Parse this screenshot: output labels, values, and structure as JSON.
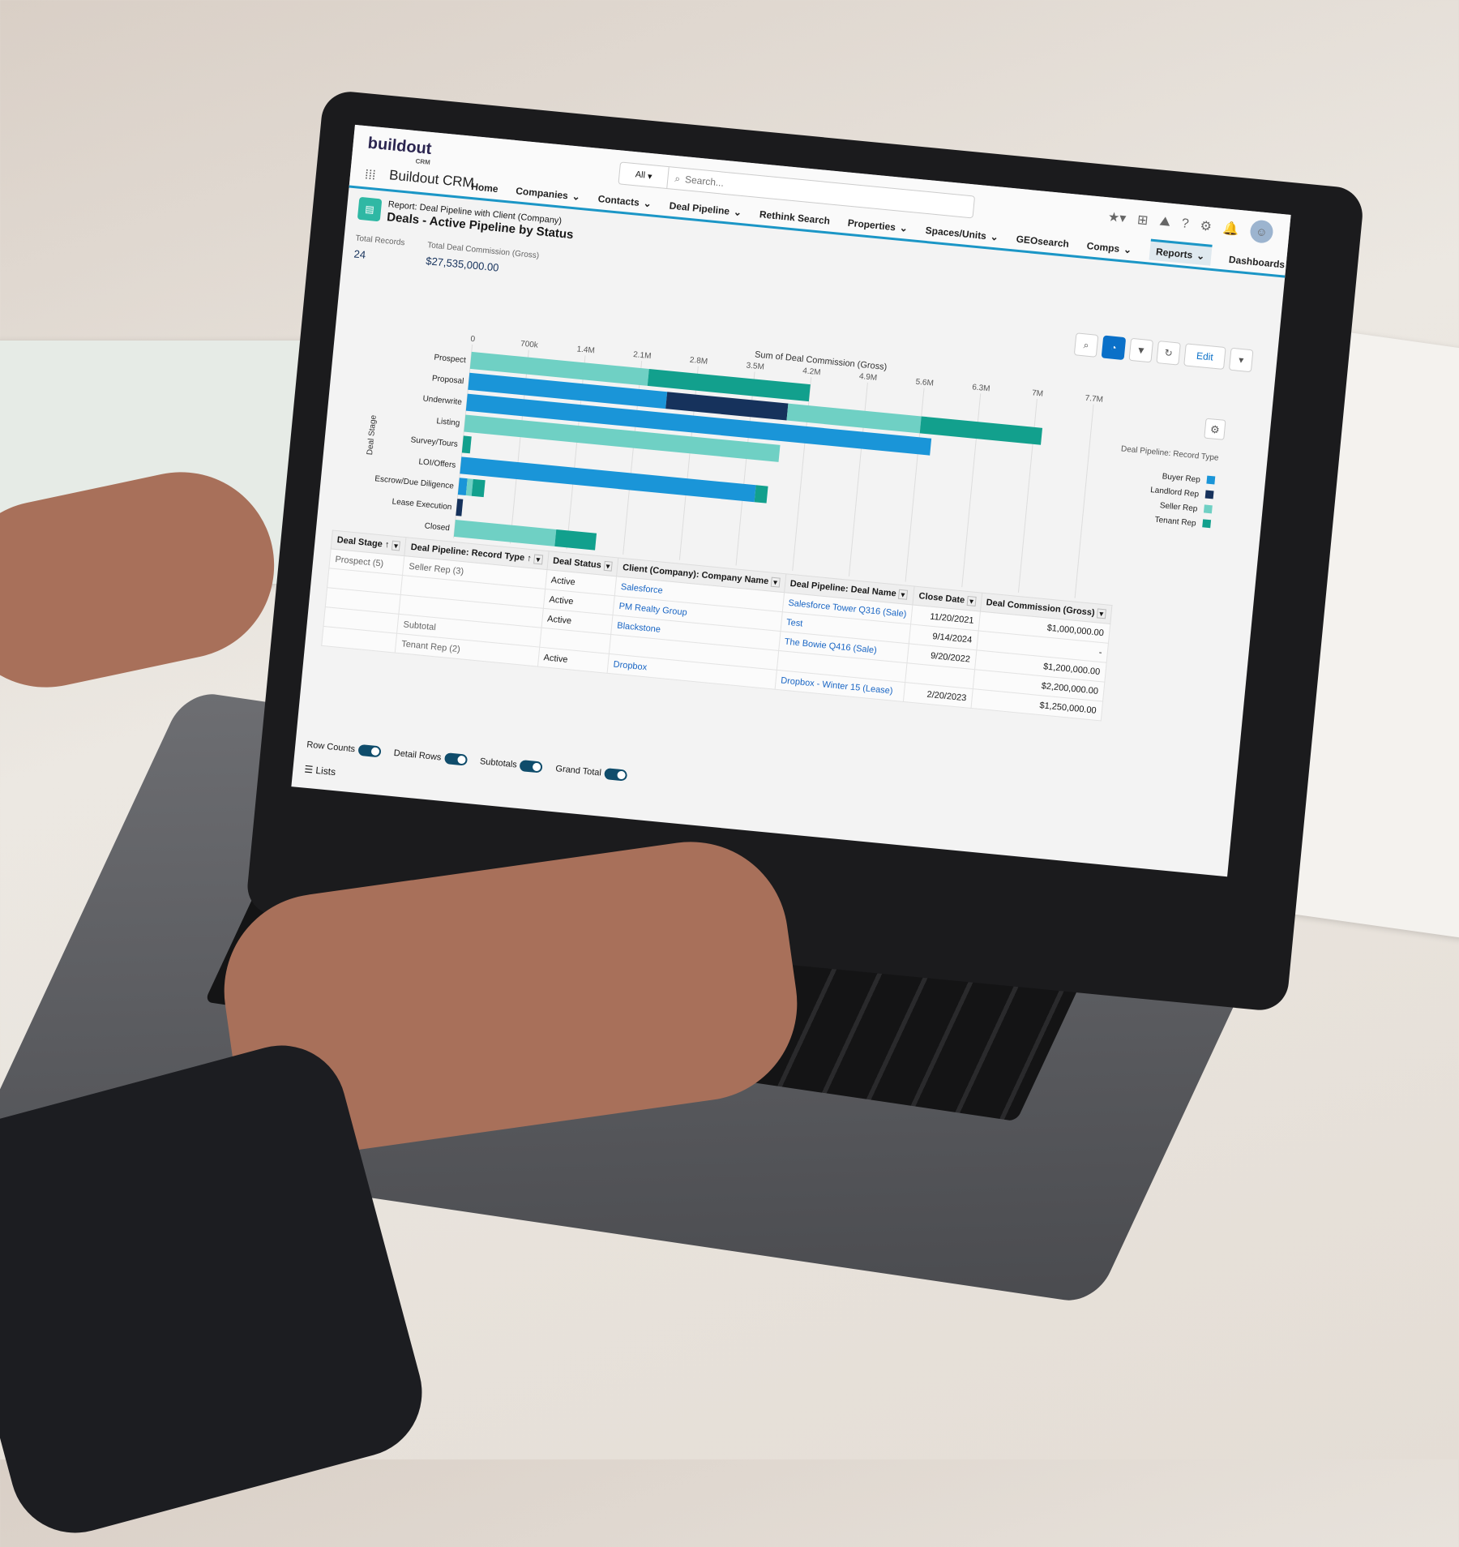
{
  "app": {
    "logo": "buildout",
    "logo_sub": "CRM",
    "name": "Buildout CRM"
  },
  "search": {
    "scope": "All",
    "placeholder": "Search..."
  },
  "nav": [
    {
      "label": "Home",
      "dropdown": false
    },
    {
      "label": "Companies",
      "dropdown": true
    },
    {
      "label": "Contacts",
      "dropdown": true
    },
    {
      "label": "Deal Pipeline",
      "dropdown": true
    },
    {
      "label": "Rethink Search",
      "dropdown": false
    },
    {
      "label": "Properties",
      "dropdown": true
    },
    {
      "label": "Spaces/Units",
      "dropdown": true
    },
    {
      "label": "GEOsearch",
      "dropdown": false
    },
    {
      "label": "Comps",
      "dropdown": true
    },
    {
      "label": "Reports",
      "dropdown": true,
      "active": true
    },
    {
      "label": "Dashboards",
      "dropdown": true
    }
  ],
  "header_icons": [
    "star-icon",
    "add-icon",
    "trailhead-icon",
    "help-icon",
    "gear-icon",
    "bell-icon",
    "avatar"
  ],
  "report": {
    "subtitle": "Report: Deal Pipeline with Client (Company)",
    "title": "Deals - Active Pipeline by Status",
    "total_records_label": "Total Records",
    "total_records": "24",
    "total_commission_label": "Total Deal Commission (Gross)",
    "total_commission": "$27,535,000.00"
  },
  "toolbar": {
    "edit_label": "Edit"
  },
  "colors": {
    "accent": "#1b96c6",
    "buyer": "#1a95d8",
    "landlord": "#16325c",
    "seller": "#6fd0c4",
    "tenant": "#12a08d"
  },
  "chart_data": {
    "type": "bar",
    "orientation": "horizontal",
    "stacked": true,
    "xlabel": "Sum of Deal Commission (Gross)",
    "ylabel": "Deal Stage",
    "xlim": [
      0,
      7700000
    ],
    "xticks": [
      "0",
      "700k",
      "1.4M",
      "2.1M",
      "2.8M",
      "3.5M",
      "4.2M",
      "4.9M",
      "5.6M",
      "6.3M",
      "7M",
      "7.7M"
    ],
    "legend_title": "Deal Pipeline: Record Type",
    "legend_position": "right",
    "categories": [
      "Prospect",
      "Proposal",
      "Underwrite",
      "Listing",
      "Survey/Tours",
      "LOI/Offers",
      "Escrow/Due Diligence",
      "Lease Execution",
      "Closed"
    ],
    "series": [
      {
        "name": "Buyer Rep",
        "values": [
          0,
          2450000,
          5750000,
          0,
          0,
          3650000,
          100000,
          0,
          0
        ]
      },
      {
        "name": "Landlord Rep",
        "values": [
          0,
          1500000,
          0,
          0,
          0,
          0,
          0,
          70000,
          0
        ]
      },
      {
        "name": "Seller Rep",
        "values": [
          2200000,
          1650000,
          0,
          3900000,
          0,
          0,
          70000,
          0,
          1250000
        ]
      },
      {
        "name": "Tenant Rep",
        "values": [
          2000000,
          1500000,
          0,
          0,
          100000,
          150000,
          150000,
          0,
          500000
        ]
      }
    ]
  },
  "table": {
    "headers": [
      "Deal Stage ↑",
      "Deal Pipeline: Record Type ↑",
      "Deal Status",
      "Client (Company): Company Name",
      "Deal Pipeline: Deal Name",
      "Close Date",
      "Deal Commission (Gross)"
    ],
    "rows": [
      [
        "Prospect (5)",
        "Seller Rep (3)",
        "Active",
        "Salesforce",
        "Salesforce Tower Q316 (Sale)",
        "11/20/2021",
        "$1,000,000.00"
      ],
      [
        "",
        "",
        "Active",
        "PM Realty Group",
        "Test",
        "9/14/2024",
        "-"
      ],
      [
        "",
        "",
        "Active",
        "Blackstone",
        "The Bowie Q416 (Sale)",
        "9/20/2022",
        "$1,200,000.00"
      ],
      [
        "",
        "Subtotal",
        "",
        "",
        "",
        "",
        "$2,200,000.00"
      ],
      [
        "",
        "Tenant Rep (2)",
        "Active",
        "Dropbox",
        "Dropbox - Winter 15 (Lease)",
        "2/20/2023",
        "$1,250,000.00"
      ]
    ]
  },
  "footer": {
    "toggles": [
      "Row Counts",
      "Detail Rows",
      "Subtotals",
      "Grand Total"
    ],
    "lists": "Lists"
  }
}
